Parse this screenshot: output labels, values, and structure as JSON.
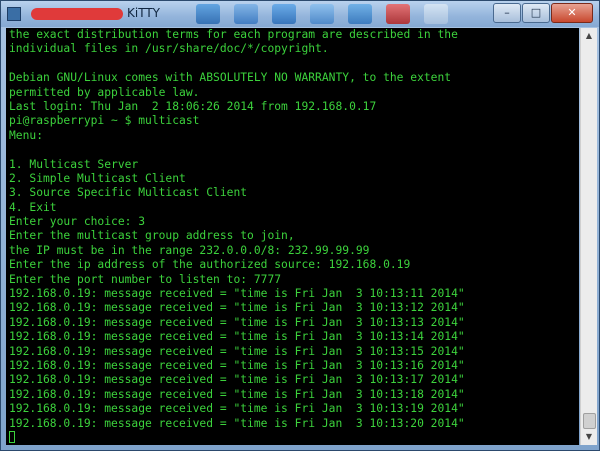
{
  "window": {
    "title": "KiTTY",
    "controls": {
      "minimize": "–",
      "maximize": "□",
      "close": "✕"
    }
  },
  "icons": {
    "app": "kitty-app-icon",
    "taskbar": [
      "blue",
      "blue",
      "blue",
      "blue",
      "blue",
      "red",
      "pale"
    ]
  },
  "terminal": {
    "lines": [
      "the exact distribution terms for each program are described in the",
      "individual files in /usr/share/doc/*/copyright.",
      "",
      "Debian GNU/Linux comes with ABSOLUTELY NO WARRANTY, to the extent",
      "permitted by applicable law.",
      "Last login: Thu Jan  2 18:06:26 2014 from 192.168.0.17",
      "pi@raspberrypi ~ $ multicast",
      "Menu:",
      "",
      "1. Multicast Server",
      "2. Simple Multicast Client",
      "3. Source Specific Multicast Client",
      "4. Exit",
      "Enter your choice: 3",
      "Enter the multicast group address to join,",
      "the IP must be in the range 232.0.0.0/8: 232.99.99.99",
      "Enter the ip address of the authorized source: 192.168.0.19",
      "Enter the port number to listen to: 7777",
      "192.168.0.19: message received = \"time is Fri Jan  3 10:13:11 2014\"",
      "192.168.0.19: message received = \"time is Fri Jan  3 10:13:12 2014\"",
      "192.168.0.19: message received = \"time is Fri Jan  3 10:13:13 2014\"",
      "192.168.0.19: message received = \"time is Fri Jan  3 10:13:14 2014\"",
      "192.168.0.19: message received = \"time is Fri Jan  3 10:13:15 2014\"",
      "192.168.0.19: message received = \"time is Fri Jan  3 10:13:16 2014\"",
      "192.168.0.19: message received = \"time is Fri Jan  3 10:13:17 2014\"",
      "192.168.0.19: message received = \"time is Fri Jan  3 10:13:18 2014\"",
      "192.168.0.19: message received = \"time is Fri Jan  3 10:13:19 2014\"",
      "192.168.0.19: message received = \"time is Fri Jan  3 10:13:20 2014\""
    ],
    "colors": {
      "background": "#000000",
      "text": "#3cd23c"
    }
  }
}
